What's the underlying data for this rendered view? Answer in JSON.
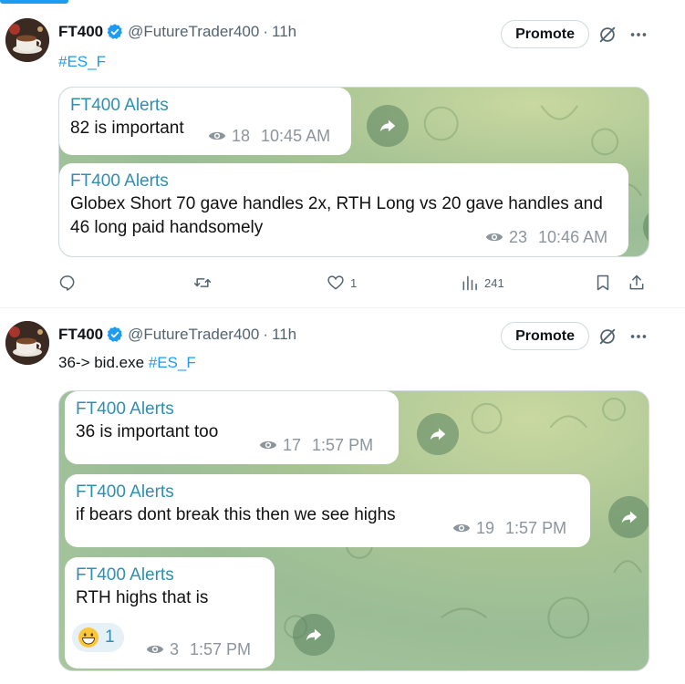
{
  "tweets": [
    {
      "author": {
        "display_name": "FT400",
        "handle": "@FutureTrader400",
        "time": "11h",
        "verified": true
      },
      "promote_label": "Promote",
      "text": "",
      "hashtag": "#ES_F",
      "messages": [
        {
          "sender": "FT400 Alerts",
          "text": "82 is important",
          "views": "18",
          "time": "10:45 AM"
        },
        {
          "sender": "FT400 Alerts",
          "text": "Globex Short 70 gave handles 2x, RTH Long vs 20 gave handles and 46 long paid handsomely",
          "views": "23",
          "time": "10:46 AM"
        }
      ],
      "actions": {
        "replies": "",
        "retweets": "",
        "likes": "1",
        "views": "241"
      }
    },
    {
      "author": {
        "display_name": "FT400",
        "handle": "@FutureTrader400",
        "time": "11h",
        "verified": true
      },
      "promote_label": "Promote",
      "text": "36-> bid.exe ",
      "hashtag": "#ES_F",
      "messages": [
        {
          "sender": "FT400 Alerts",
          "text": "36 is important too",
          "views": "17",
          "time": "1:57 PM"
        },
        {
          "sender": "FT400 Alerts",
          "text": "if bears dont break this then we see highs",
          "views": "19",
          "time": "1:57 PM"
        },
        {
          "sender": "FT400 Alerts",
          "text": "RTH highs that is",
          "views": "3",
          "time": "1:57 PM",
          "reaction": {
            "emoji": "grinning-face",
            "count": "1"
          }
        }
      ]
    }
  ],
  "colors": {
    "accent": "#1d9bf0",
    "sender": "#2f8fb3",
    "muted": "#536471"
  }
}
